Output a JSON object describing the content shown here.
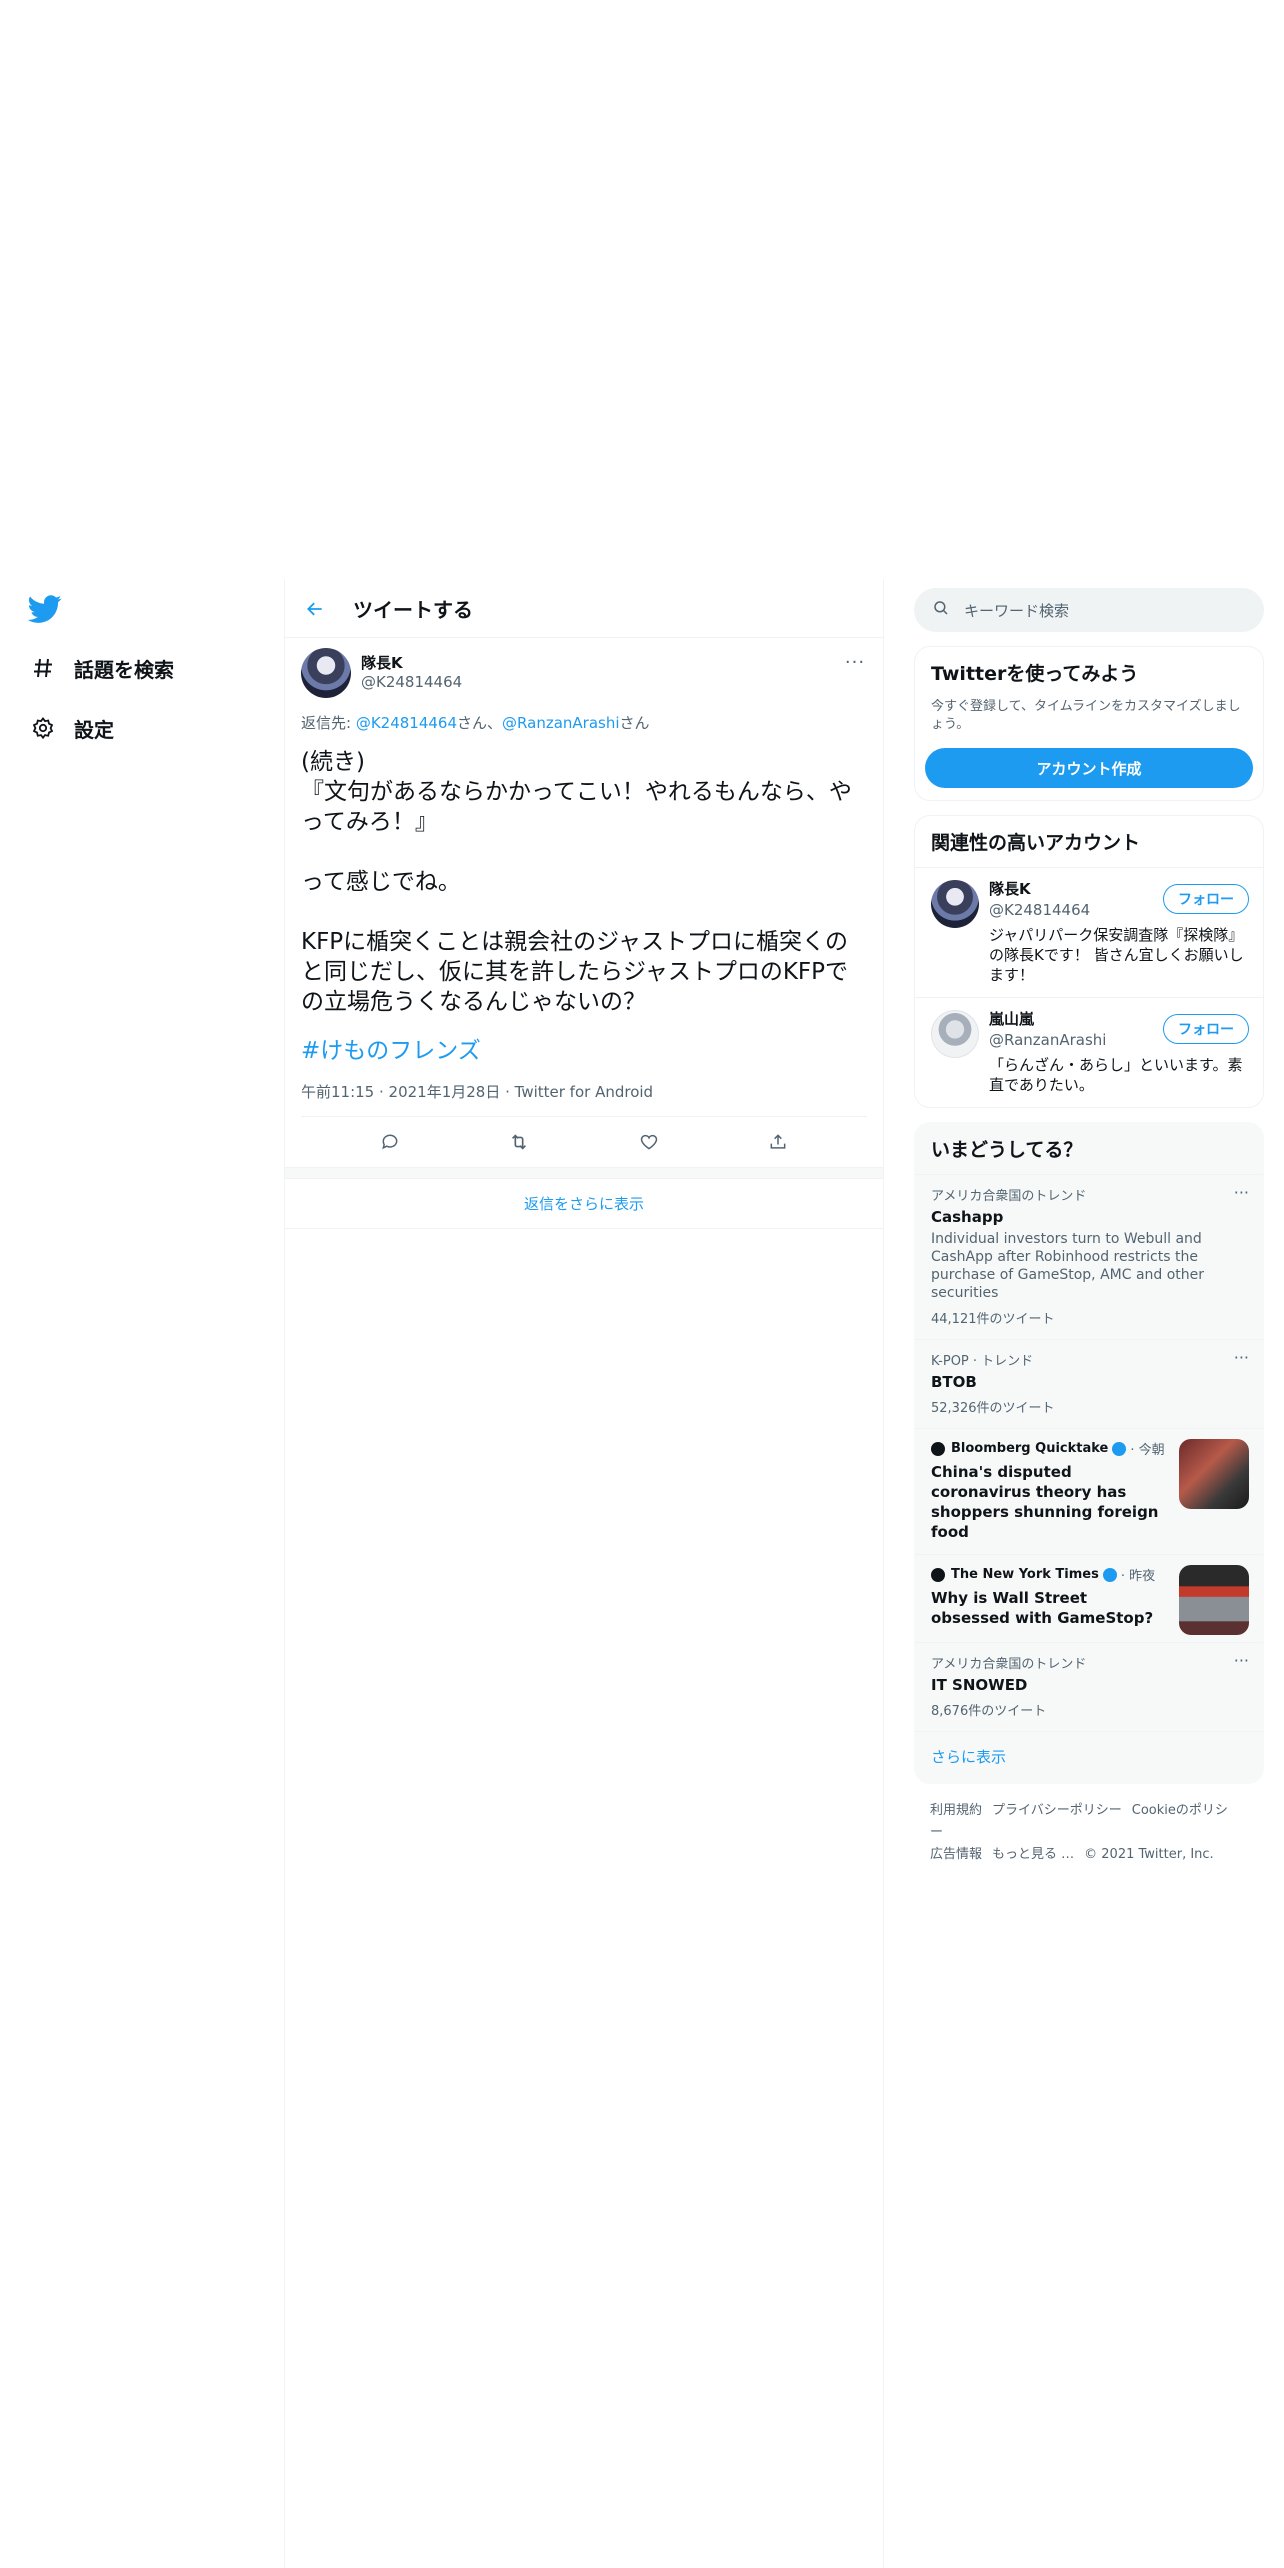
{
  "nav": {
    "items": [
      {
        "label": "話題を検索",
        "icon": "hashtag-icon"
      },
      {
        "label": "設定",
        "icon": "gear-icon"
      }
    ]
  },
  "main": {
    "header_title": "ツイートする",
    "tweet": {
      "display_name": "隊長K",
      "handle": "@K24814464",
      "reply_prefix": "返信先: ",
      "reply_user1": "@K24814464",
      "reply_san1": "さん、",
      "reply_user2": "@RanzanArashi",
      "reply_san2": "さん",
      "body": "(続き)\n『文句があるならかかってこい！やれるもんなら、やってみろ！』\n\nって感じでね。\n\nKFPに楯突くことは親会社のジャストプロに楯突くのと同じだし、仮に其を許したらジャストプロのKFPでの立場危うくなるんじゃないの？",
      "hashtag": "#けものフレンズ",
      "meta": "午前11:15 · 2021年1月28日 · Twitter for Android"
    },
    "show_more_replies": "返信をさらに表示"
  },
  "right": {
    "search_placeholder": "キーワード検索",
    "signup": {
      "title": "Twitterを使ってみよう",
      "subtitle": "今すぐ登録して、タイムラインをカスタマイズしましょう。",
      "button": "アカウント作成"
    },
    "relevant": {
      "title": "関連性の高いアカウント",
      "accounts": [
        {
          "name": "隊長K",
          "handle": "@K24814464",
          "bio": "ジャパリパーク保安調査隊『探検隊』の隊長Kです！ 皆さん宜しくお願いします！",
          "follow": "フォロー"
        },
        {
          "name": "嵐山嵐",
          "handle": "@RanzanArashi",
          "bio": "「らんざん・あらし」といいます。素直でありたい。",
          "follow": "フォロー"
        }
      ]
    },
    "trends": {
      "title": "いまどうしてる？",
      "items": [
        {
          "context": "アメリカ合衆国のトレンド",
          "topic": "Cashapp",
          "desc": "Individual investors turn to Webull and CashApp after Robinhood restricts the purchase of GameStop, AMC and other securities",
          "count": "44,121件のツイート"
        },
        {
          "context": "K-POP · トレンド",
          "topic": "BTOB",
          "count": "52,326件のツイート"
        },
        {
          "context": "アメリカ合衆国のトレンド",
          "topic": "IT SNOWED",
          "count": "8,676件のツイート"
        }
      ],
      "news": [
        {
          "publisher": "Bloomberg Quicktake",
          "time": "· 今朝",
          "headline": "China's disputed coronavirus theory has shoppers shunning foreign food"
        },
        {
          "publisher": "The New York Times",
          "time": "· 昨夜",
          "headline": "Why is Wall Street obsessed with GameStop?"
        }
      ],
      "show_more": "さらに表示"
    },
    "footer": {
      "links": [
        "利用規約",
        "プライバシーポリシー",
        "Cookieのポリシー",
        "広告情報",
        "もっと見る …",
        "© 2021 Twitter, Inc."
      ]
    }
  },
  "colors": {
    "accent": "#1d9bf0",
    "text": "#0f1419",
    "secondary": "#536471",
    "border": "#eff3f4"
  }
}
